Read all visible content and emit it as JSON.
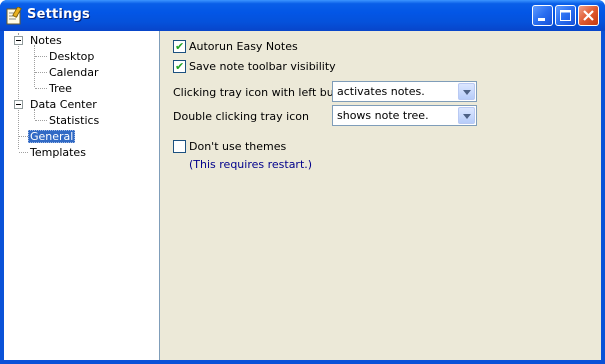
{
  "window": {
    "title": "Settings"
  },
  "tree": {
    "items": [
      {
        "label": "Notes"
      },
      {
        "label": "Desktop"
      },
      {
        "label": "Calendar"
      },
      {
        "label": "Tree"
      },
      {
        "label": "Data Center"
      },
      {
        "label": "Statistics"
      },
      {
        "label": "General",
        "selected": true
      },
      {
        "label": "Templates"
      }
    ]
  },
  "general": {
    "autorun": {
      "label": "Autorun Easy Notes",
      "checked": true
    },
    "save_toolbar": {
      "label": "Save note toolbar visibility",
      "checked": true
    },
    "tray_left": {
      "label": "Clicking tray icon with left button",
      "value": "activates notes."
    },
    "tray_double": {
      "label": "Double clicking tray icon",
      "value": "shows note tree."
    },
    "no_themes": {
      "label": "Don't use themes",
      "checked": false
    },
    "restart_note": "(This requires restart.)"
  },
  "colors": {
    "titlebar": "#0356e6",
    "selection": "#316ac5",
    "panel": "#ece9d8",
    "note_text": "#00008b"
  }
}
